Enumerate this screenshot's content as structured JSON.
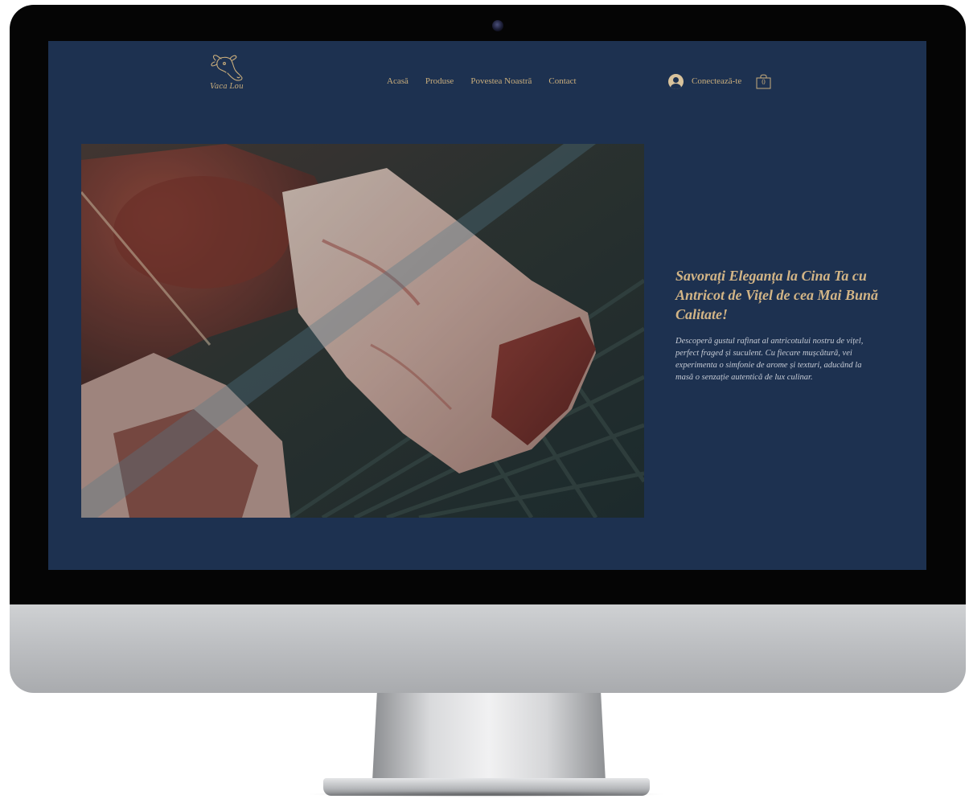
{
  "site": {
    "logo_text": "Vaca Lou",
    "nav": [
      "Acasă",
      "Produse",
      "Povestea Noastră",
      "Contact"
    ],
    "login_label": "Conectează-te",
    "cart_count": "0"
  },
  "hero": {
    "title": "Savorați Eleganța la Cina Ta cu Antricot de Vițel de cea Mai Bună Calitate!",
    "description": "Descoperă gustul rafinat al antricotului nostru de vițel, perfect fraged și suculent. Cu fiecare mușcătură, vei experimenta o simfonie de arome și texturi, aducând la masă o senzație autentică de lux culinar."
  },
  "colors": {
    "page_background": "#1d3150",
    "accent_gold": "#c9ad7c"
  },
  "icons": {
    "user": "user-avatar-icon",
    "cart": "shopping-bag-icon",
    "logo": "cow-head-logo"
  }
}
